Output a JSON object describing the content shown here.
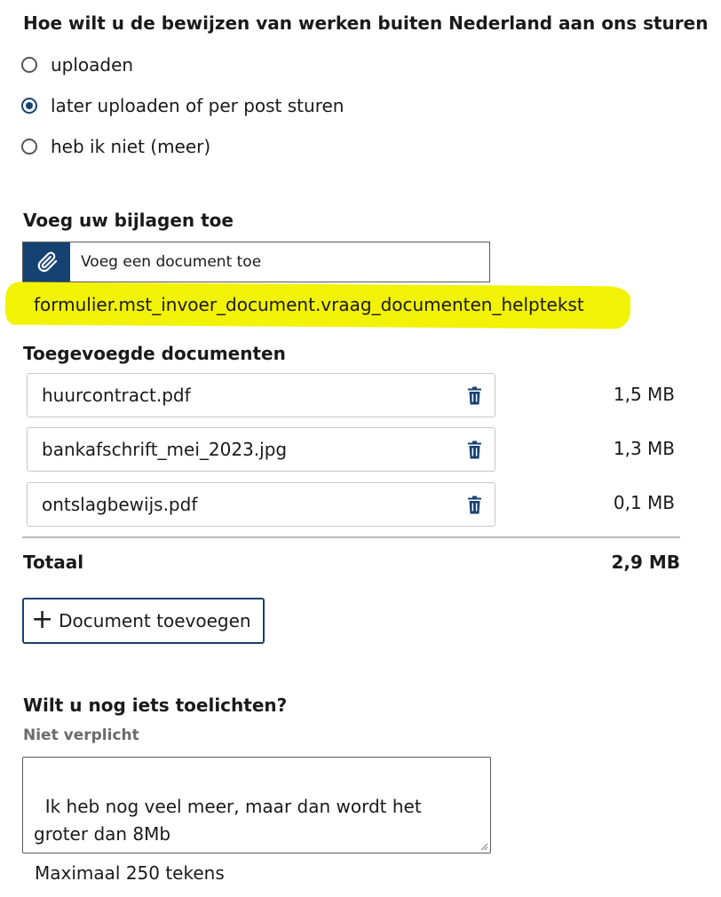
{
  "send_method": {
    "question": "Hoe wilt u de bewijzen van werken buiten Nederland aan ons sturen",
    "options": [
      {
        "label": "uploaden",
        "selected": false
      },
      {
        "label": "later uploaden of per post sturen",
        "selected": true
      },
      {
        "label": "heb ik niet (meer)",
        "selected": false
      }
    ]
  },
  "attachments": {
    "title": "Voeg uw bijlagen toe",
    "upload_label": "Voeg een document toe",
    "upload_icon": "paperclip-icon",
    "helptext": "formulier.mst_invoer_document.vraag_documenten_helptekst",
    "highlight_color": "#f2f205"
  },
  "documents": {
    "title": "Toegevoegde documenten",
    "items": [
      {
        "name": "huurcontract.pdf",
        "size": "1,5 MB"
      },
      {
        "name": "bankafschrift_mei_2023.jpg",
        "size": "1,3 MB"
      },
      {
        "name": "ontslagbewijs.pdf",
        "size": "0,1 MB"
      }
    ],
    "delete_icon": "trash-icon",
    "total_label": "Totaal",
    "total_value": "2,9 MB",
    "add_button": "Document toevoegen"
  },
  "comments": {
    "question": "Wilt u nog iets toelichten?",
    "optional_label": "Niet verplicht",
    "value": "Ik heb nog veel meer, maar dan wordt het groter dan 8Mb",
    "max_hint": "Maximaal 250 tekens"
  },
  "colors": {
    "accent": "#154273",
    "text": "#1a1a1a",
    "muted": "#6b6b6b"
  }
}
